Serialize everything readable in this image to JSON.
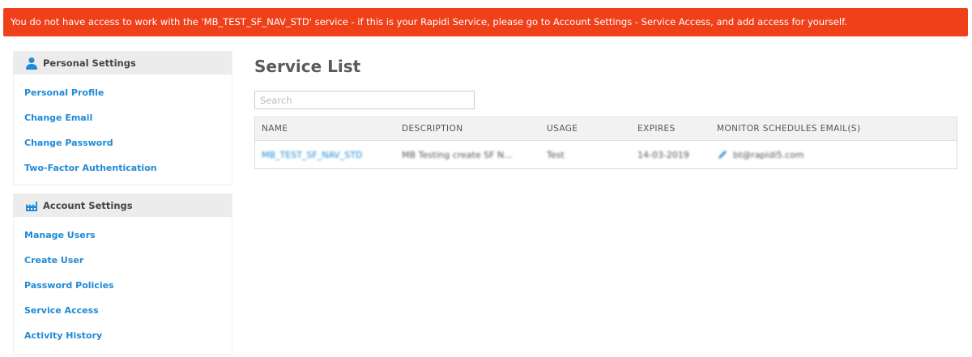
{
  "alert": {
    "message": "You do not have access to work with the 'MB_TEST_SF_NAV_STD' service - if this is your Rapidi Service, please go to Account Settings - Service Access, and add access for yourself."
  },
  "sidebar": {
    "personal": {
      "title": "Personal Settings",
      "icon": "user-icon",
      "items": [
        {
          "label": "Personal Profile"
        },
        {
          "label": "Change Email"
        },
        {
          "label": "Change Password"
        },
        {
          "label": "Two-Factor Authentication"
        }
      ]
    },
    "account": {
      "title": "Account Settings",
      "icon": "factory-icon",
      "items": [
        {
          "label": "Manage Users"
        },
        {
          "label": "Create User"
        },
        {
          "label": "Password Policies"
        },
        {
          "label": "Service Access"
        },
        {
          "label": "Activity History"
        }
      ]
    }
  },
  "main": {
    "title": "Service List",
    "search": {
      "placeholder": "Search",
      "value": ""
    },
    "table": {
      "columns": [
        "NAME",
        "DESCRIPTION",
        "USAGE",
        "EXPIRES",
        "MONITOR SCHEDULES EMAIL(S)"
      ],
      "rows": [
        {
          "name": "MB_TEST_SF_NAV_STD",
          "description": "MB Testing create SF N...",
          "usage": "Test",
          "expires": "14-03-2019",
          "email": "bt@rapidi5.com",
          "email_icon": "pencil-icon"
        }
      ]
    }
  },
  "colors": {
    "alert_bg": "#f0401a",
    "link": "#1f8ad6",
    "panel_head_bg": "#ececec"
  }
}
